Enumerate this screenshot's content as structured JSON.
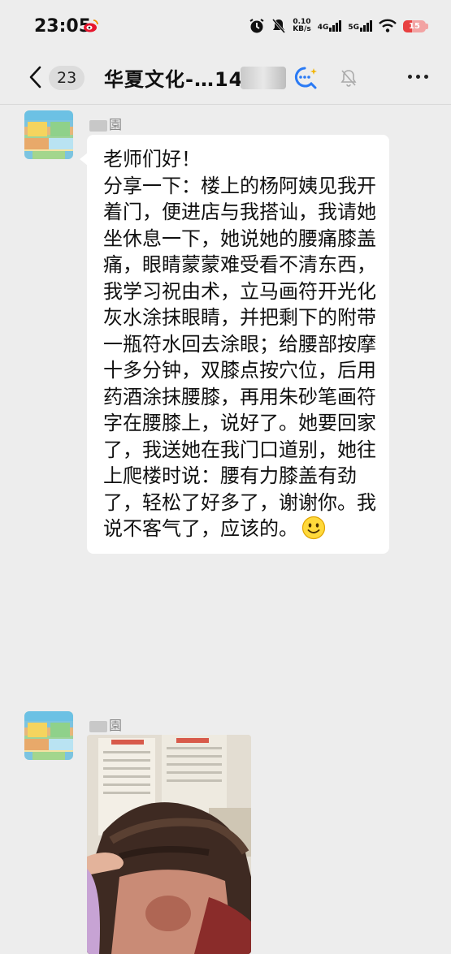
{
  "status_bar": {
    "time": "23:05",
    "speed_value": "0.10",
    "speed_unit": "KB/s",
    "net1": "4G",
    "net2": "5G",
    "battery": "15"
  },
  "header": {
    "unread_count": "23",
    "title": "华夏文化-…14"
  },
  "messages": [
    {
      "sender": "園",
      "text": "老师们好！\n分享一下：楼上的杨阿姨见我开着门，便进店与我搭讪，我请她坐休息一下，她说她的腰痛膝盖痛，眼睛蒙蒙难受看不清东西，我学习祝由术，立马画符开光化灰水涂抹眼睛，并把剩下的附带一瓶符水回去涂眼；给腰部按摩十多分钟，双膝点按穴位，后用药酒涂抹腰膝，再用朱砂笔画符字在腰膝上，说好了。她要回家了，我送她在我门口道别，她往上爬楼时说：腰有力膝盖有劲了，轻松了好多了，谢谢你。我说不客气了，应该的。",
      "emoji": "smile-emoji"
    },
    {
      "sender": "園",
      "type": "image"
    }
  ],
  "colors": {
    "background": "#ededed",
    "bubble": "#ffffff",
    "battery": "#e84040"
  }
}
